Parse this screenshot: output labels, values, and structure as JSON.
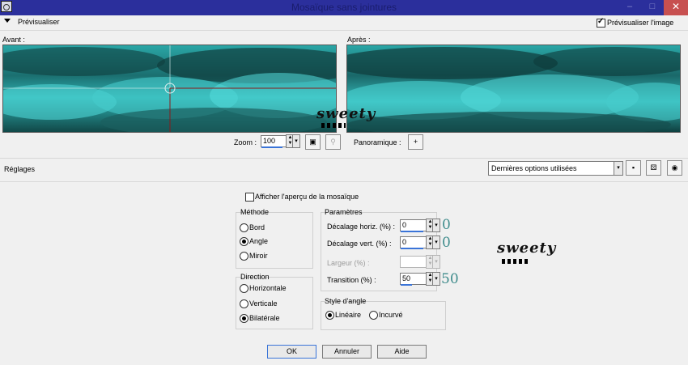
{
  "window": {
    "title": "Mosaïque sans jointures",
    "buttons": {
      "minimize": "–",
      "maximize": "□",
      "close": "✕"
    }
  },
  "preview": {
    "section_label": "Prévisualiser",
    "preview_image_label": "Prévisualiser l'image",
    "preview_image_checked": true,
    "before_label": "Avant :",
    "after_label": "Après :"
  },
  "zoom": {
    "label": "Zoom :",
    "value": "100",
    "pan_label": "Panoramique :",
    "pan_button": "+"
  },
  "settings": {
    "label": "Réglages",
    "preset_value": "Dernières options utilisées"
  },
  "options": {
    "show_tile_preview_label": "Afficher l'aperçu de la mosaïque",
    "show_tile_preview_checked": false
  },
  "method": {
    "title": "Méthode",
    "options": [
      "Bord",
      "Angle",
      "Miroir"
    ],
    "selected": "Angle"
  },
  "direction": {
    "title": "Direction",
    "options": [
      "Horizontale",
      "Verticale",
      "Bilatérale"
    ],
    "selected": "Bilatérale"
  },
  "params": {
    "title": "Paramètres",
    "h_offset_label": "Décalage horiz. (%) :",
    "h_offset_value": "0",
    "v_offset_label": "Décalage vert. (%) :",
    "v_offset_value": "0",
    "width_label": "Largeur (%) :",
    "width_value": "",
    "transition_label": "Transition (%) :",
    "transition_value": "50"
  },
  "annotations": {
    "h_offset": "0",
    "v_offset": "0",
    "transition": "50"
  },
  "corner_style": {
    "title": "Style d'angle",
    "options": [
      "Linéaire",
      "Incurvé"
    ],
    "selected": "Linéaire"
  },
  "watermark": {
    "text": "sweety"
  },
  "buttons": {
    "ok": "OK",
    "cancel": "Annuler",
    "help": "Aide"
  },
  "colors": {
    "titlebar": "#2b2f9c",
    "sky_light": "#3cc7c7",
    "sky_dark": "#0f4040",
    "accent": "#3a74d8",
    "annotation": "#3f8c8c"
  }
}
